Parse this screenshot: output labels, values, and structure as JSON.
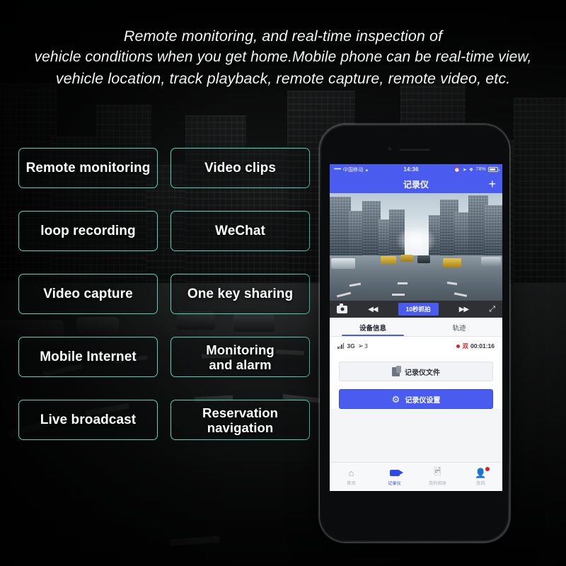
{
  "headline": {
    "line1": "Remote monitoring, and real-time inspection of",
    "line2": "vehicle conditions when you get home.Mobile phone can be real-time view,",
    "line3": "vehicle location, track playback, remote capture, remote video, etc."
  },
  "features": {
    "accent_color": "#4fd6b5",
    "items": [
      {
        "label": "Remote monitoring"
      },
      {
        "label": "Video clips"
      },
      {
        "label": "loop recording"
      },
      {
        "label": "WeChat"
      },
      {
        "label": "Video capture"
      },
      {
        "label": "One key sharing"
      },
      {
        "label": "Mobile Internet"
      },
      {
        "label": "Monitoring\nand alarm"
      },
      {
        "label": "Live broadcast"
      },
      {
        "label": "Reservation\nnavigation"
      }
    ]
  },
  "phone": {
    "status_bar": {
      "signal_dots": "•••••",
      "carrier": "中国移动",
      "wifi_icon": "wifi-icon",
      "time": "14:36",
      "battery_percent": "78%"
    },
    "app_bar": {
      "title": "记录仪",
      "add_label": "+"
    },
    "video_controls": {
      "camera_icon": "camera-icon",
      "rewind_label": "◀◀",
      "snapshot_label": "10秒抓拍",
      "forward_label": "▶▶",
      "fullscreen_icon": "expand-icon"
    },
    "tabs": [
      {
        "label": "设备信息",
        "active": true
      },
      {
        "label": "轨迹",
        "active": false
      }
    ],
    "info_row": {
      "network": "3G",
      "satellite_count": "3",
      "record_mode": "双",
      "record_time": "00:01:16"
    },
    "actions": [
      {
        "label": "记录仪文件",
        "icon": "file-icon",
        "style": "light"
      },
      {
        "label": "记录仪设置",
        "icon": "gear-icon",
        "style": "primary"
      }
    ],
    "bottom_nav": [
      {
        "label": "首页",
        "icon": "home-icon",
        "active": false,
        "badge": false
      },
      {
        "label": "记录仪",
        "icon": "video-camera-icon",
        "active": true,
        "badge": false
      },
      {
        "label": "我的相册",
        "icon": "gallery-icon",
        "active": false,
        "badge": false
      },
      {
        "label": "我的",
        "icon": "person-icon",
        "active": false,
        "badge": true
      }
    ],
    "accent_color": "#4a5cf0"
  }
}
